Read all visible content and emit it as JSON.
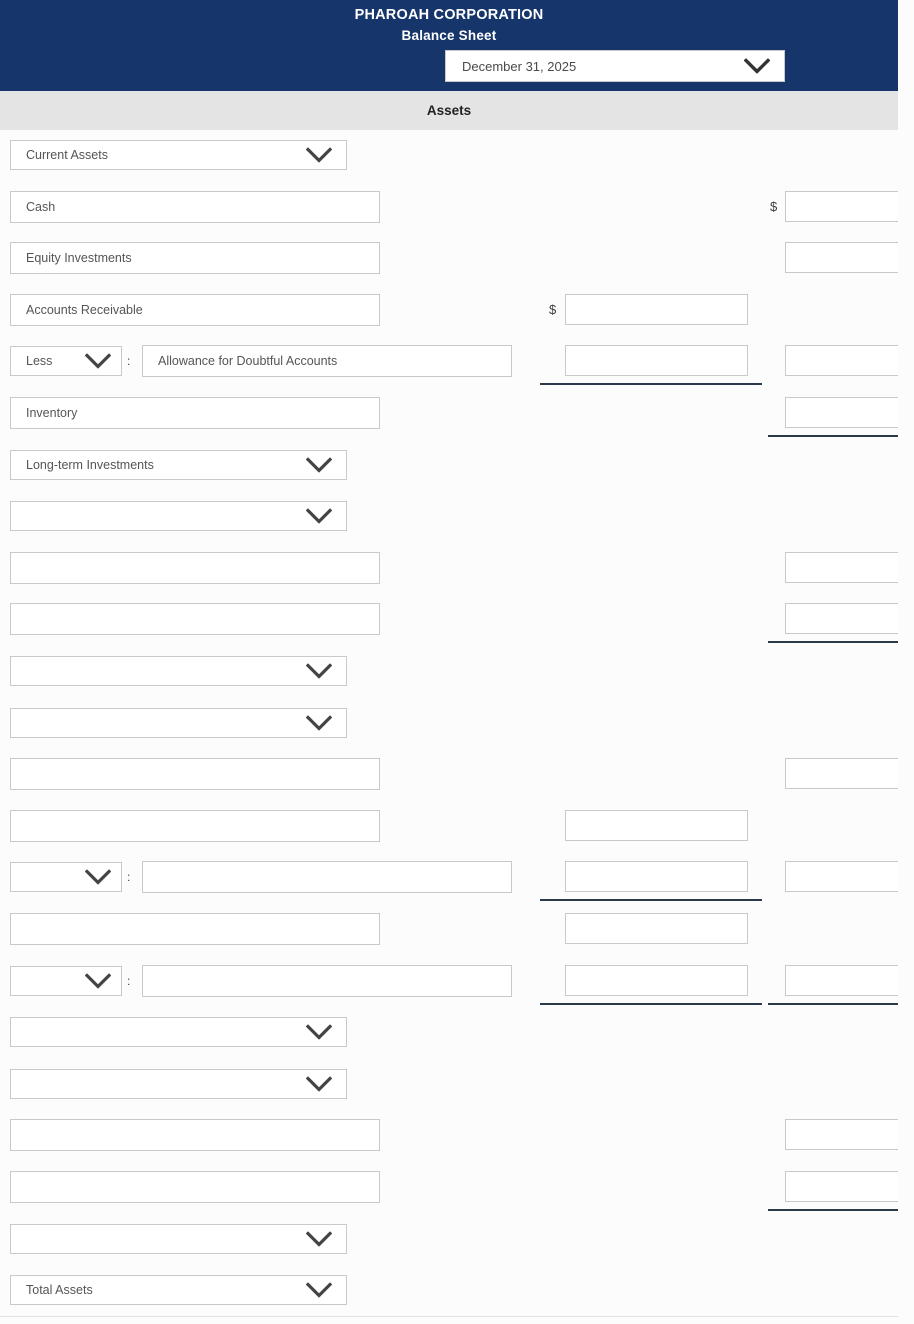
{
  "header": {
    "company": "PHAROAH CORPORATION",
    "statement": "Balance Sheet",
    "date_value": "December 31, 2025",
    "date_icon": "chevron-down-icon",
    "bg_color": "#16356b"
  },
  "section_band": {
    "title": "Assets",
    "bg_color": "#e4e4e4"
  },
  "symbols": {
    "dollar": "$",
    "colon": ":"
  },
  "rows": [
    {
      "id": "r1",
      "kind": "select",
      "label": "Current Assets",
      "col_b": null,
      "col_c": null
    },
    {
      "id": "r2",
      "kind": "input",
      "label": "Cash",
      "col_b": null,
      "col_c": {
        "value": "",
        "dollar": true
      }
    },
    {
      "id": "r3",
      "kind": "input",
      "label": "Equity Investments",
      "col_b": null,
      "col_c": {
        "value": "",
        "dollar": false
      }
    },
    {
      "id": "r4",
      "kind": "input",
      "label": "Accounts Receivable",
      "col_b": {
        "value": "",
        "dollar": true
      },
      "col_c": null
    },
    {
      "id": "r5",
      "kind": "less",
      "label": "Less",
      "sub_label": "Allowance for Doubtful Accounts",
      "col_b": {
        "value": "",
        "dollar": false,
        "rule": true
      },
      "col_c": {
        "value": "",
        "dollar": false
      }
    },
    {
      "id": "r6",
      "kind": "input",
      "label": "Inventory",
      "col_b": null,
      "col_c": {
        "value": "",
        "dollar": false,
        "rule": true
      }
    },
    {
      "id": "r7",
      "kind": "select",
      "label": "Long-term Investments",
      "col_b": null,
      "col_c": null
    },
    {
      "id": "r8",
      "kind": "select",
      "label": "",
      "col_b": null,
      "col_c": null
    },
    {
      "id": "r9",
      "kind": "input",
      "label": "",
      "col_b": null,
      "col_c": {
        "value": "",
        "dollar": false
      }
    },
    {
      "id": "r10",
      "kind": "input",
      "label": "",
      "col_b": null,
      "col_c": {
        "value": "",
        "dollar": false,
        "rule": true
      }
    },
    {
      "id": "r11",
      "kind": "select",
      "label": "",
      "col_b": null,
      "col_c": null
    },
    {
      "id": "r12",
      "kind": "select",
      "label": "",
      "col_b": null,
      "col_c": null
    },
    {
      "id": "r13",
      "kind": "input",
      "label": "",
      "col_b": null,
      "col_c": {
        "value": "",
        "dollar": false
      }
    },
    {
      "id": "r14",
      "kind": "input",
      "label": "",
      "col_b": {
        "value": "",
        "dollar": false
      },
      "col_c": null
    },
    {
      "id": "r15",
      "kind": "less",
      "label": "",
      "sub_label": "",
      "col_b": {
        "value": "",
        "dollar": false,
        "rule": true
      },
      "col_c": {
        "value": "",
        "dollar": false
      }
    },
    {
      "id": "r16",
      "kind": "input",
      "label": "",
      "col_b": {
        "value": "",
        "dollar": false
      },
      "col_c": null
    },
    {
      "id": "r17",
      "kind": "less",
      "label": "",
      "sub_label": "",
      "col_b": {
        "value": "",
        "dollar": false,
        "rule": true
      },
      "col_c": {
        "value": "",
        "dollar": false,
        "rule": true
      }
    },
    {
      "id": "r18",
      "kind": "select",
      "label": "",
      "col_b": null,
      "col_c": null
    },
    {
      "id": "r19",
      "kind": "select",
      "label": "",
      "col_b": null,
      "col_c": null
    },
    {
      "id": "r20",
      "kind": "input",
      "label": "",
      "col_b": null,
      "col_c": {
        "value": "",
        "dollar": false
      }
    },
    {
      "id": "r21",
      "kind": "input",
      "label": "",
      "col_b": null,
      "col_c": {
        "value": "",
        "dollar": false,
        "rule": true
      }
    },
    {
      "id": "r22",
      "kind": "select",
      "label": "",
      "col_b": null,
      "col_c": null
    },
    {
      "id": "r23",
      "kind": "select",
      "label": "Total Assets",
      "col_b": null,
      "col_c": null
    }
  ]
}
